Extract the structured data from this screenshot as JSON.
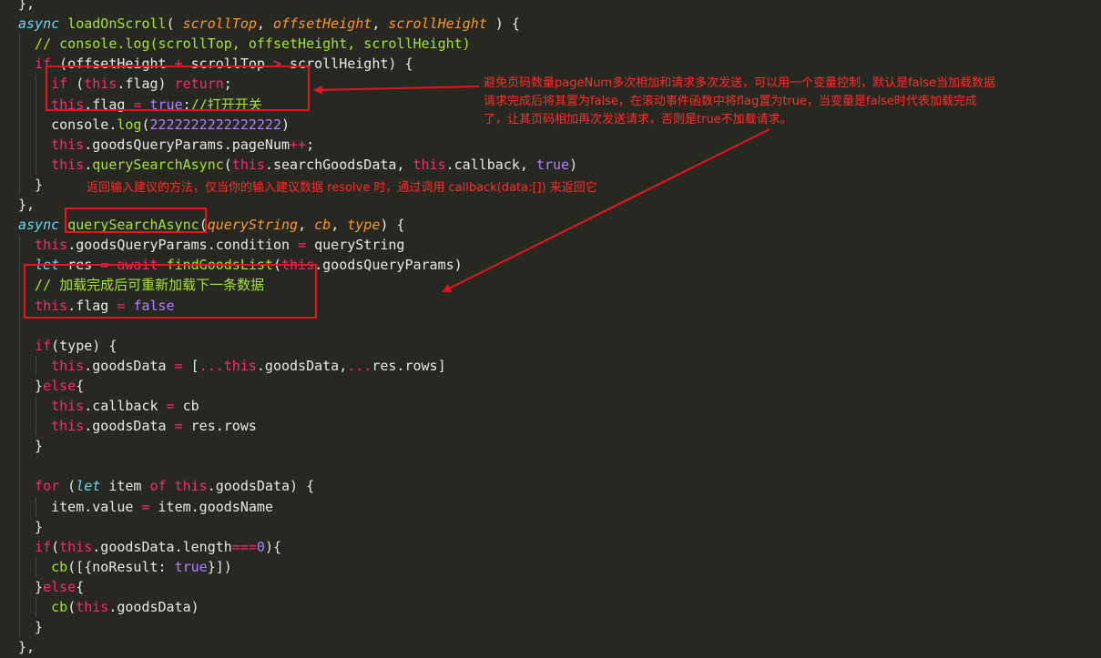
{
  "colors": {
    "background": "#272822",
    "annotation_red": "#e8131c",
    "keyword": "#66d9ef",
    "function_name": "#a6e22e",
    "parameter": "#fd971f",
    "this_keyword": "#f92672",
    "constant": "#ae81ff",
    "comment": "#a6e22e"
  },
  "editor": {
    "lines": [
      [
        {
          "t": "},",
          "c": "plain"
        }
      ],
      [
        {
          "t": "async ",
          "c": "kw2"
        },
        {
          "t": "loadOnScroll",
          "c": "fn"
        },
        {
          "t": "( ",
          "c": "plain"
        },
        {
          "t": "scrollTop",
          "c": "param"
        },
        {
          "t": ", ",
          "c": "plain"
        },
        {
          "t": "offsetHeight",
          "c": "param"
        },
        {
          "t": ", ",
          "c": "plain"
        },
        {
          "t": "scrollHeight",
          "c": "param"
        },
        {
          "t": " ) {",
          "c": "plain"
        }
      ],
      [
        {
          "t": "  // console.log(scrollTop, offsetHeight, scrollHeight)",
          "c": "cmt"
        }
      ],
      [
        {
          "t": "  ",
          "c": "plain"
        },
        {
          "t": "if",
          "c": "kw"
        },
        {
          "t": " (offsetHeight ",
          "c": "plain"
        },
        {
          "t": "+",
          "c": "op"
        },
        {
          "t": " scrollTop ",
          "c": "plain"
        },
        {
          "t": ">",
          "c": "op"
        },
        {
          "t": " scrollHeight) {",
          "c": "plain"
        }
      ],
      [
        {
          "t": "    ",
          "c": "plain"
        },
        {
          "t": "if",
          "c": "kw"
        },
        {
          "t": " (",
          "c": "plain"
        },
        {
          "t": "this",
          "c": "this"
        },
        {
          "t": ".flag) ",
          "c": "plain"
        },
        {
          "t": "return",
          "c": "kw"
        },
        {
          "t": ";",
          "c": "plain"
        }
      ],
      [
        {
          "t": "    ",
          "c": "plain"
        },
        {
          "t": "this",
          "c": "this"
        },
        {
          "t": ".flag ",
          "c": "plain"
        },
        {
          "t": "=",
          "c": "op"
        },
        {
          "t": " ",
          "c": "plain"
        },
        {
          "t": "true",
          "c": "const"
        },
        {
          "t": ";",
          "c": "plain"
        },
        {
          "t": "//打开开关",
          "c": "cmt"
        }
      ],
      [
        {
          "t": "    console.",
          "c": "plain"
        },
        {
          "t": "log",
          "c": "fn"
        },
        {
          "t": "(",
          "c": "plain"
        },
        {
          "t": "2222222222222222",
          "c": "const"
        },
        {
          "t": ")",
          "c": "plain"
        }
      ],
      [
        {
          "t": "    ",
          "c": "plain"
        },
        {
          "t": "this",
          "c": "this"
        },
        {
          "t": ".goodsQueryParams.pageNum",
          "c": "plain"
        },
        {
          "t": "++",
          "c": "op"
        },
        {
          "t": ";",
          "c": "plain"
        }
      ],
      [
        {
          "t": "    ",
          "c": "plain"
        },
        {
          "t": "this",
          "c": "this"
        },
        {
          "t": ".",
          "c": "plain"
        },
        {
          "t": "querySearchAsync",
          "c": "fn"
        },
        {
          "t": "(",
          "c": "plain"
        },
        {
          "t": "this",
          "c": "this"
        },
        {
          "t": ".searchGoodsData, ",
          "c": "plain"
        },
        {
          "t": "this",
          "c": "this"
        },
        {
          "t": ".callback, ",
          "c": "plain"
        },
        {
          "t": "true",
          "c": "const"
        },
        {
          "t": ")",
          "c": "plain"
        }
      ],
      [
        {
          "t": "  }",
          "c": "plain"
        }
      ],
      [
        {
          "t": "},",
          "c": "plain"
        }
      ],
      [
        {
          "t": "async ",
          "c": "kw2"
        },
        {
          "t": "querySearchAsync",
          "c": "fn"
        },
        {
          "t": "(",
          "c": "plain"
        },
        {
          "t": "queryString",
          "c": "param"
        },
        {
          "t": ", ",
          "c": "plain"
        },
        {
          "t": "cb",
          "c": "param"
        },
        {
          "t": ", ",
          "c": "plain"
        },
        {
          "t": "type",
          "c": "param"
        },
        {
          "t": ") {",
          "c": "plain"
        }
      ],
      [
        {
          "t": "  ",
          "c": "plain"
        },
        {
          "t": "this",
          "c": "this"
        },
        {
          "t": ".goodsQueryParams.condition ",
          "c": "plain"
        },
        {
          "t": "=",
          "c": "op"
        },
        {
          "t": " queryString",
          "c": "plain"
        }
      ],
      [
        {
          "t": "  ",
          "c": "plain"
        },
        {
          "t": "let",
          "c": "kw2"
        },
        {
          "t": " res ",
          "c": "plain"
        },
        {
          "t": "=",
          "c": "op"
        },
        {
          "t": " ",
          "c": "plain"
        },
        {
          "t": "await",
          "c": "kw"
        },
        {
          "t": " ",
          "c": "plain"
        },
        {
          "t": "findGoodsList",
          "c": "fn"
        },
        {
          "t": "(",
          "c": "plain"
        },
        {
          "t": "this",
          "c": "this"
        },
        {
          "t": ".goodsQueryParams)",
          "c": "plain"
        }
      ],
      [
        {
          "t": "  // 加载完成后可重新加载下一条数据",
          "c": "cmt"
        }
      ],
      [
        {
          "t": "  ",
          "c": "plain"
        },
        {
          "t": "this",
          "c": "this"
        },
        {
          "t": ".flag ",
          "c": "plain"
        },
        {
          "t": "=",
          "c": "op"
        },
        {
          "t": " ",
          "c": "plain"
        },
        {
          "t": "false",
          "c": "const"
        }
      ],
      [],
      [
        {
          "t": "  ",
          "c": "plain"
        },
        {
          "t": "if",
          "c": "kw"
        },
        {
          "t": "(type) {",
          "c": "plain"
        }
      ],
      [
        {
          "t": "    ",
          "c": "plain"
        },
        {
          "t": "this",
          "c": "this"
        },
        {
          "t": ".goodsData ",
          "c": "plain"
        },
        {
          "t": "=",
          "c": "op"
        },
        {
          "t": " [",
          "c": "plain"
        },
        {
          "t": "...",
          "c": "op"
        },
        {
          "t": "this",
          "c": "this"
        },
        {
          "t": ".goodsData,",
          "c": "plain"
        },
        {
          "t": "...",
          "c": "op"
        },
        {
          "t": "res.rows]",
          "c": "plain"
        }
      ],
      [
        {
          "t": "  }",
          "c": "plain"
        },
        {
          "t": "else",
          "c": "kw"
        },
        {
          "t": "{",
          "c": "plain"
        }
      ],
      [
        {
          "t": "    ",
          "c": "plain"
        },
        {
          "t": "this",
          "c": "this"
        },
        {
          "t": ".callback ",
          "c": "plain"
        },
        {
          "t": "=",
          "c": "op"
        },
        {
          "t": " cb",
          "c": "plain"
        }
      ],
      [
        {
          "t": "    ",
          "c": "plain"
        },
        {
          "t": "this",
          "c": "this"
        },
        {
          "t": ".goodsData ",
          "c": "plain"
        },
        {
          "t": "=",
          "c": "op"
        },
        {
          "t": " res.rows",
          "c": "plain"
        }
      ],
      [
        {
          "t": "  }",
          "c": "plain"
        }
      ],
      [],
      [
        {
          "t": "  ",
          "c": "plain"
        },
        {
          "t": "for",
          "c": "kw"
        },
        {
          "t": " (",
          "c": "plain"
        },
        {
          "t": "let",
          "c": "kw2"
        },
        {
          "t": " item ",
          "c": "plain"
        },
        {
          "t": "of",
          "c": "kw"
        },
        {
          "t": " ",
          "c": "plain"
        },
        {
          "t": "this",
          "c": "this"
        },
        {
          "t": ".goodsData) {",
          "c": "plain"
        }
      ],
      [
        {
          "t": "    item.value ",
          "c": "plain"
        },
        {
          "t": "=",
          "c": "op"
        },
        {
          "t": " item.goodsName",
          "c": "plain"
        }
      ],
      [
        {
          "t": "  }",
          "c": "plain"
        }
      ],
      [
        {
          "t": "  ",
          "c": "plain"
        },
        {
          "t": "if",
          "c": "kw"
        },
        {
          "t": "(",
          "c": "plain"
        },
        {
          "t": "this",
          "c": "this"
        },
        {
          "t": ".goodsData.length",
          "c": "plain"
        },
        {
          "t": "===",
          "c": "op"
        },
        {
          "t": "0",
          "c": "const"
        },
        {
          "t": "){",
          "c": "plain"
        }
      ],
      [
        {
          "t": "    ",
          "c": "plain"
        },
        {
          "t": "cb",
          "c": "fn"
        },
        {
          "t": "([{noResult: ",
          "c": "plain"
        },
        {
          "t": "true",
          "c": "const"
        },
        {
          "t": "}])",
          "c": "plain"
        }
      ],
      [
        {
          "t": "  }",
          "c": "plain"
        },
        {
          "t": "else",
          "c": "kw"
        },
        {
          "t": "{",
          "c": "plain"
        }
      ],
      [
        {
          "t": "    ",
          "c": "plain"
        },
        {
          "t": "cb",
          "c": "fn"
        },
        {
          "t": "(",
          "c": "plain"
        },
        {
          "t": "this",
          "c": "this"
        },
        {
          "t": ".goodsData)",
          "c": "plain"
        }
      ],
      [
        {
          "t": "  }",
          "c": "plain"
        }
      ],
      [
        {
          "t": "},",
          "c": "plain"
        }
      ]
    ]
  },
  "annotations": {
    "flag_note_line1": "避免页码数量pageNum多次相加和请求多次发送，可以用一个变量控制，默认是false当加载数据",
    "flag_note_line2": "请求完成后将其置为false，在滚动事件函数中将flag置为true，当变量是false时代表加载完成",
    "flag_note_line3": "了，让其页码相加再次发送请求，否则是true不加载请求。",
    "query_note": "返回输入建议的方法，仅当你的输入建议数据 resolve 时，通过调用 callback(data:[]) 来返回它"
  }
}
